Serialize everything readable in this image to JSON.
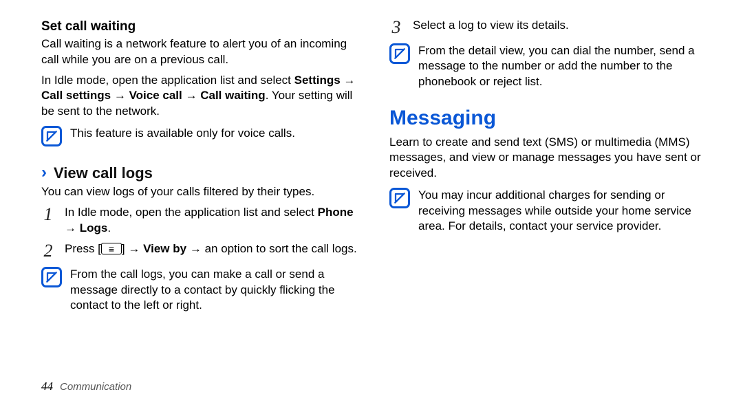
{
  "left": {
    "h_set_call_waiting": "Set call waiting",
    "p_cw_desc": "Call waiting is a network feature to alert you of an incoming call while you are on a previous call.",
    "p_idle_prefix": "In Idle mode, open the application list and select ",
    "p_idle_path_settings": "Settings",
    "p_idle_path_call_settings": "Call settings",
    "p_idle_path_voice_call": "Voice call",
    "p_idle_path_call_waiting": "Call waiting",
    "p_idle_suffix": ". Your setting will be sent to the network.",
    "note_voice_only": "This feature is available only for voice calls.",
    "h_view_call_logs": "View call logs",
    "p_view_logs_desc": "You can view logs of your calls filtered by their types.",
    "step1_prefix": "In Idle mode, open the application list and select ",
    "step1_path_phone": "Phone",
    "step1_path_logs": "Logs",
    "step1_suffix": ".",
    "step2_prefix": "Press [",
    "step2_mid1": "] ",
    "step2_view_by": "View by",
    "step2_suffix": " an option to sort the call logs.",
    "note_flick": "From the call logs, you can make a call or send a message directly to a contact by quickly flicking the contact to the left or right."
  },
  "right": {
    "step3_text": "Select a log to view its details.",
    "note_detail": "From the detail view, you can dial the number, send a message to the number or add the number to the phonebook or reject list.",
    "h_messaging": "Messaging",
    "p_messaging_desc": "Learn to create and send text (SMS) or multimedia (MMS) messages, and view or manage messages you have sent or received.",
    "note_charges": "You may incur additional charges for sending or receiving messages while outside your home service area. For details, contact your service provider."
  },
  "step_numbers": {
    "s1": "1",
    "s2": "2",
    "s3": "3"
  },
  "footer": {
    "page": "44",
    "section": "Communication"
  },
  "arrow": "→"
}
